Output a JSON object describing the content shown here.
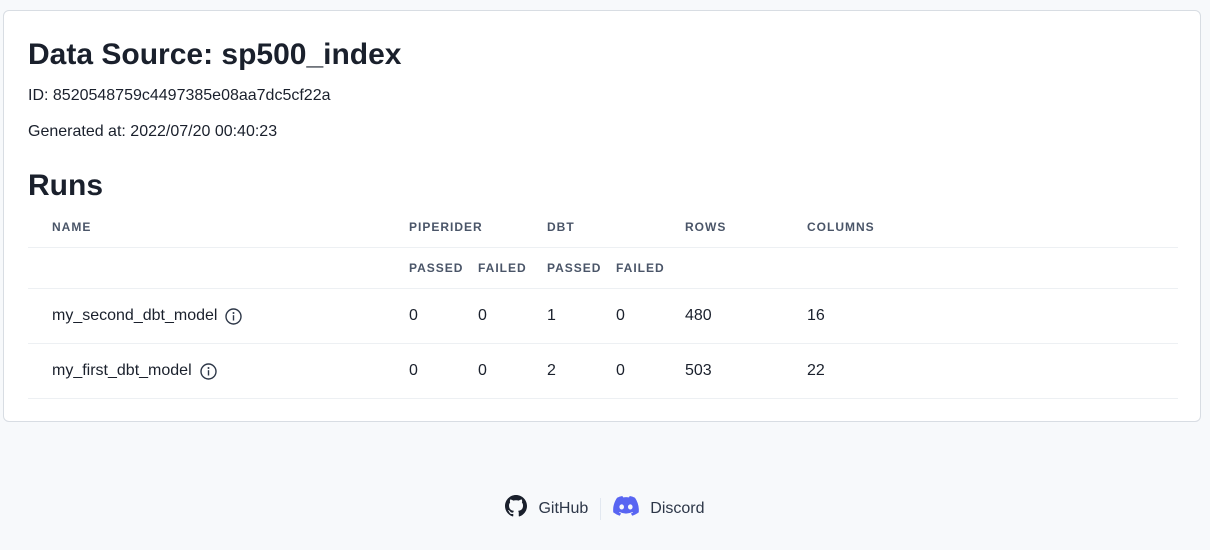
{
  "data_source": {
    "title": "Data Source: sp500_index",
    "id_text": "ID: 8520548759c4497385e08aa7dc5cf22a",
    "generated_text": "Generated at: 2022/07/20 00:40:23"
  },
  "runs": {
    "title": "Runs",
    "headers": {
      "name": "NAME",
      "piperider": "PIPERIDER",
      "dbt": "DBT",
      "rows": "ROWS",
      "columns": "COLUMNS",
      "passed": "PASSED",
      "failed": "FAILED"
    },
    "rows": [
      {
        "name": "my_second_dbt_model",
        "piperider_passed": "0",
        "piperider_failed": "0",
        "dbt_passed": "1",
        "dbt_failed": "0",
        "rows": "480",
        "columns": "16"
      },
      {
        "name": "my_first_dbt_model",
        "piperider_passed": "0",
        "piperider_failed": "0",
        "dbt_passed": "2",
        "dbt_failed": "0",
        "rows": "503",
        "columns": "22"
      }
    ]
  },
  "footer": {
    "github_label": "GitHub",
    "discord_label": "Discord",
    "github_icon": "github-icon",
    "discord_icon": "discord-icon",
    "discord_color": "#5865f2"
  },
  "icons": {
    "info": "info-circle-icon"
  }
}
